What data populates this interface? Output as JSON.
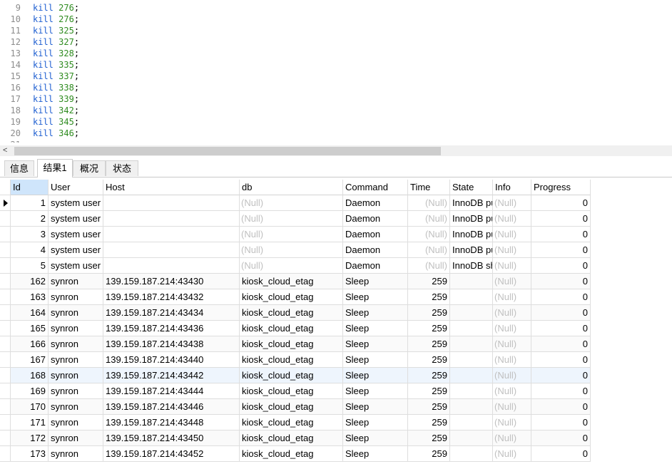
{
  "editor": {
    "lines": [
      {
        "no": "9",
        "kw": "kill",
        "val": "276"
      },
      {
        "no": "10",
        "kw": "kill",
        "val": "276"
      },
      {
        "no": "11",
        "kw": "kill",
        "val": "325"
      },
      {
        "no": "12",
        "kw": "kill",
        "val": "327"
      },
      {
        "no": "13",
        "kw": "kill",
        "val": "328"
      },
      {
        "no": "14",
        "kw": "kill",
        "val": "335"
      },
      {
        "no": "15",
        "kw": "kill",
        "val": "337"
      },
      {
        "no": "16",
        "kw": "kill",
        "val": "338"
      },
      {
        "no": "17",
        "kw": "kill",
        "val": "339"
      },
      {
        "no": "18",
        "kw": "kill",
        "val": "342"
      },
      {
        "no": "19",
        "kw": "kill",
        "val": "345"
      },
      {
        "no": "20",
        "kw": "kill",
        "val": "346"
      }
    ],
    "partial_line_no": "21",
    "semicolon": ";"
  },
  "scrollbar": {
    "left_arrow": "<"
  },
  "tabs": [
    {
      "label": "信息",
      "active": false
    },
    {
      "label": "结果1",
      "active": true
    },
    {
      "label": "概况",
      "active": false
    },
    {
      "label": "状态",
      "active": false
    }
  ],
  "grid": {
    "columns": [
      "Id",
      "User",
      "Host",
      "db",
      "Command",
      "Time",
      "State",
      "Info",
      "Progress"
    ],
    "null_text": "(Null)",
    "rows": [
      {
        "id": "1",
        "user": "system user",
        "host": "",
        "db": null,
        "command": "Daemon",
        "time": null,
        "state": "InnoDB pu",
        "info": null,
        "progress": "0"
      },
      {
        "id": "2",
        "user": "system user",
        "host": "",
        "db": null,
        "command": "Daemon",
        "time": null,
        "state": "InnoDB pu",
        "info": null,
        "progress": "0"
      },
      {
        "id": "3",
        "user": "system user",
        "host": "",
        "db": null,
        "command": "Daemon",
        "time": null,
        "state": "InnoDB pu",
        "info": null,
        "progress": "0"
      },
      {
        "id": "4",
        "user": "system user",
        "host": "",
        "db": null,
        "command": "Daemon",
        "time": null,
        "state": "InnoDB pu",
        "info": null,
        "progress": "0"
      },
      {
        "id": "5",
        "user": "system user",
        "host": "",
        "db": null,
        "command": "Daemon",
        "time": null,
        "state": "InnoDB sh",
        "info": null,
        "progress": "0"
      },
      {
        "id": "162",
        "user": "synron",
        "host": "139.159.187.214:43430",
        "db": "kiosk_cloud_etag",
        "command": "Sleep",
        "time": "259",
        "state": "",
        "info": null,
        "progress": "0"
      },
      {
        "id": "163",
        "user": "synron",
        "host": "139.159.187.214:43432",
        "db": "kiosk_cloud_etag",
        "command": "Sleep",
        "time": "259",
        "state": "",
        "info": null,
        "progress": "0"
      },
      {
        "id": "164",
        "user": "synron",
        "host": "139.159.187.214:43434",
        "db": "kiosk_cloud_etag",
        "command": "Sleep",
        "time": "259",
        "state": "",
        "info": null,
        "progress": "0"
      },
      {
        "id": "165",
        "user": "synron",
        "host": "139.159.187.214:43436",
        "db": "kiosk_cloud_etag",
        "command": "Sleep",
        "time": "259",
        "state": "",
        "info": null,
        "progress": "0"
      },
      {
        "id": "166",
        "user": "synron",
        "host": "139.159.187.214:43438",
        "db": "kiosk_cloud_etag",
        "command": "Sleep",
        "time": "259",
        "state": "",
        "info": null,
        "progress": "0"
      },
      {
        "id": "167",
        "user": "synron",
        "host": "139.159.187.214:43440",
        "db": "kiosk_cloud_etag",
        "command": "Sleep",
        "time": "259",
        "state": "",
        "info": null,
        "progress": "0"
      },
      {
        "id": "168",
        "user": "synron",
        "host": "139.159.187.214:43442",
        "db": "kiosk_cloud_etag",
        "command": "Sleep",
        "time": "259",
        "state": "",
        "info": null,
        "progress": "0"
      },
      {
        "id": "169",
        "user": "synron",
        "host": "139.159.187.214:43444",
        "db": "kiosk_cloud_etag",
        "command": "Sleep",
        "time": "259",
        "state": "",
        "info": null,
        "progress": "0"
      },
      {
        "id": "170",
        "user": "synron",
        "host": "139.159.187.214:43446",
        "db": "kiosk_cloud_etag",
        "command": "Sleep",
        "time": "259",
        "state": "",
        "info": null,
        "progress": "0"
      },
      {
        "id": "171",
        "user": "synron",
        "host": "139.159.187.214:43448",
        "db": "kiosk_cloud_etag",
        "command": "Sleep",
        "time": "259",
        "state": "",
        "info": null,
        "progress": "0"
      },
      {
        "id": "172",
        "user": "synron",
        "host": "139.159.187.214:43450",
        "db": "kiosk_cloud_etag",
        "command": "Sleep",
        "time": "259",
        "state": "",
        "info": null,
        "progress": "0"
      },
      {
        "id": "173",
        "user": "synron",
        "host": "139.159.187.214:43452",
        "db": "kiosk_cloud_etag",
        "command": "Sleep",
        "time": "259",
        "state": "",
        "info": null,
        "progress": "0"
      }
    ]
  },
  "colors": {
    "keyword": "#1f5fd1",
    "number": "#2e8b1f",
    "null": "#c0c0c0",
    "header_selected": "#cfe5fb"
  }
}
